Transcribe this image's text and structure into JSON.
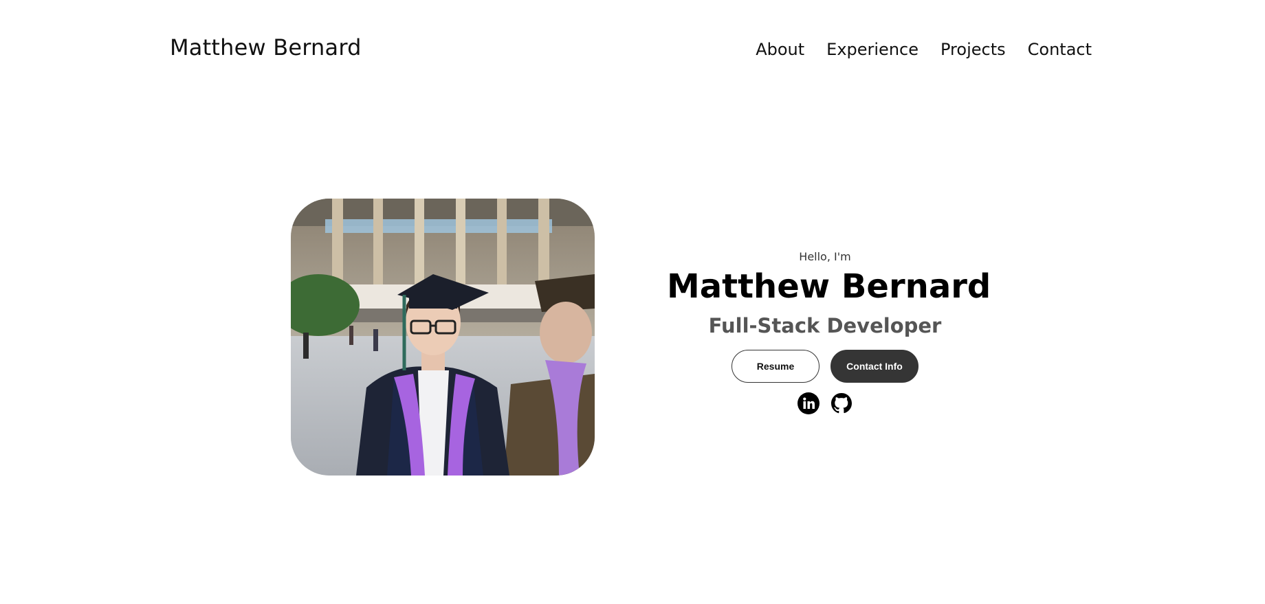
{
  "header": {
    "site_name": "Matthew Bernard",
    "nav": [
      {
        "label": "About"
      },
      {
        "label": "Experience"
      },
      {
        "label": "Projects"
      },
      {
        "label": "Contact"
      }
    ]
  },
  "hero": {
    "greeting": "Hello, I'm",
    "name": "Matthew Bernard",
    "title": "Full-Stack Developer",
    "buttons": {
      "resume_label": "Resume",
      "contact_label": "Contact Info"
    },
    "social": [
      {
        "icon": "linkedin-icon"
      },
      {
        "icon": "github-icon"
      }
    ],
    "photo_alt": "Profile picture"
  },
  "colors": {
    "text": "#000000",
    "subtitle": "#555555",
    "button_dark": "#353535",
    "background": "#ffffff"
  }
}
